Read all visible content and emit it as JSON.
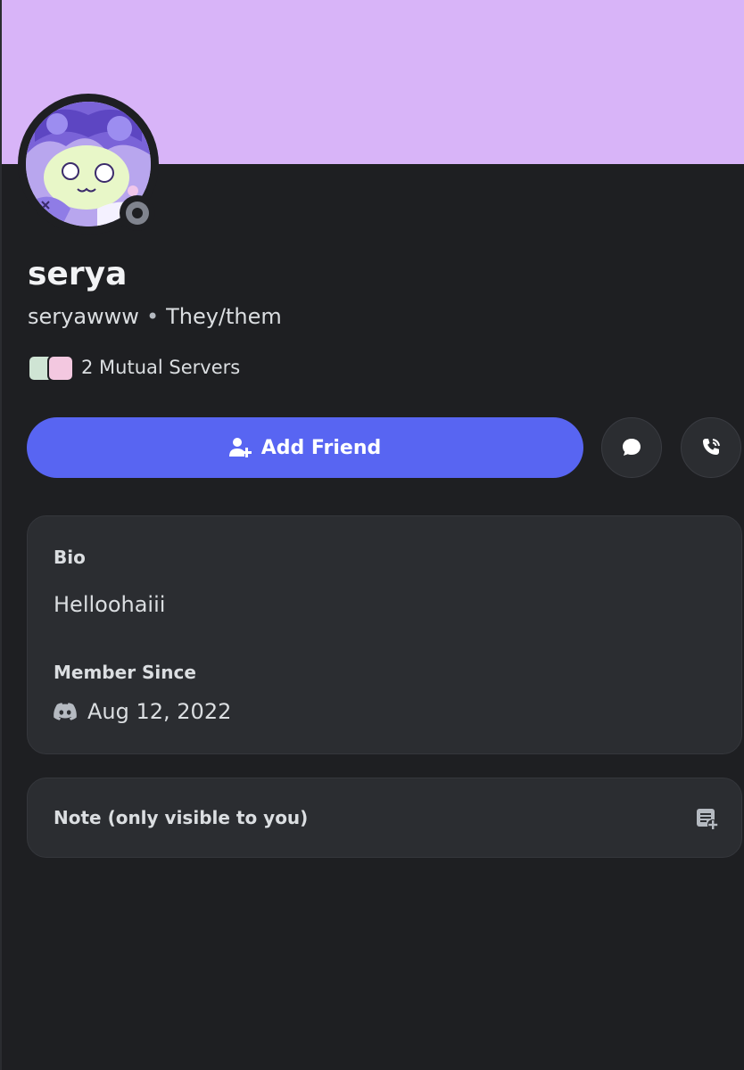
{
  "profile": {
    "display_name": "serya",
    "username": "seryawww",
    "separator": "•",
    "pronouns": "They/them",
    "status": "offline",
    "banner_color": "#d8b4f8",
    "avatar_icon": "avatar-image"
  },
  "mutual": {
    "label": "2 Mutual Servers",
    "server_icons": [
      "server-icon",
      "server-icon"
    ]
  },
  "actions": {
    "add_friend_label": "Add Friend",
    "add_friend_icon": "add-user-icon",
    "message_icon": "chat-bubble-icon",
    "call_icon": "phone-icon",
    "accent_color": "#5865f2"
  },
  "bio_card": {
    "bio_heading": "Bio",
    "bio_text": "Helloohaiii",
    "member_heading": "Member Since",
    "member_icon": "discord-icon",
    "member_date": "Aug 12, 2022"
  },
  "note_card": {
    "heading": "Note (only visible to you)",
    "icon": "add-note-icon"
  }
}
